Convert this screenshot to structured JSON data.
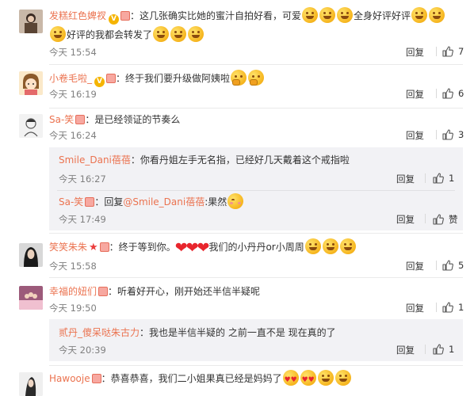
{
  "actions": {
    "reply": "回复",
    "like_label": "赞"
  },
  "comments": [
    {
      "user": "发糕红色婢衩",
      "text_a": "：这几张确实比她的蜜汁自拍好看，可爱",
      "text_b": "全身好评好评",
      "text_c": "好评的我都会转发了",
      "time": "今天 15:54",
      "likes": "7"
    },
    {
      "user": "小卷毛啦_",
      "text_a": "：终于我们要升级做阿姨啦",
      "time": "今天 16:19",
      "likes": "6"
    },
    {
      "user": "Sa-笑",
      "text_a": "：是已经领证的节奏么",
      "time": "今天 16:24",
      "likes": "3",
      "replies": [
        {
          "user": "Smile_Dani蓓蓓",
          "text": "：你看丹姐左手无名指，已经好几天戴着这个戒指啦",
          "time": "今天 16:27",
          "likes": "1"
        },
        {
          "user": "Sa-笑",
          "text_pre": "：回复",
          "mention": "@Smile_Dani蓓蓓",
          "text": ":果然",
          "time": "今天 17:49",
          "likes": ""
        }
      ]
    },
    {
      "user": "笑笑朱朱",
      "text_a": "：终于等到你。",
      "text_b": "我们的小丹丹or小周周",
      "time": "今天 15:58",
      "likes": "5"
    },
    {
      "user": "幸福的妞们",
      "text_a": "：听着好开心，刚开始还半信半疑呢",
      "time": "今天 19:50",
      "likes": "1",
      "replies": [
        {
          "user": "贰丹_傻呆哒朱古力",
          "text": "：我也是半信半疑的 之前一直不是 现在真的了",
          "time": "今天 20:39",
          "likes": "1"
        }
      ]
    },
    {
      "user": "Hawooje",
      "text_a": "：恭喜恭喜，我们二小姐果真已经是妈妈了"
    }
  ]
}
